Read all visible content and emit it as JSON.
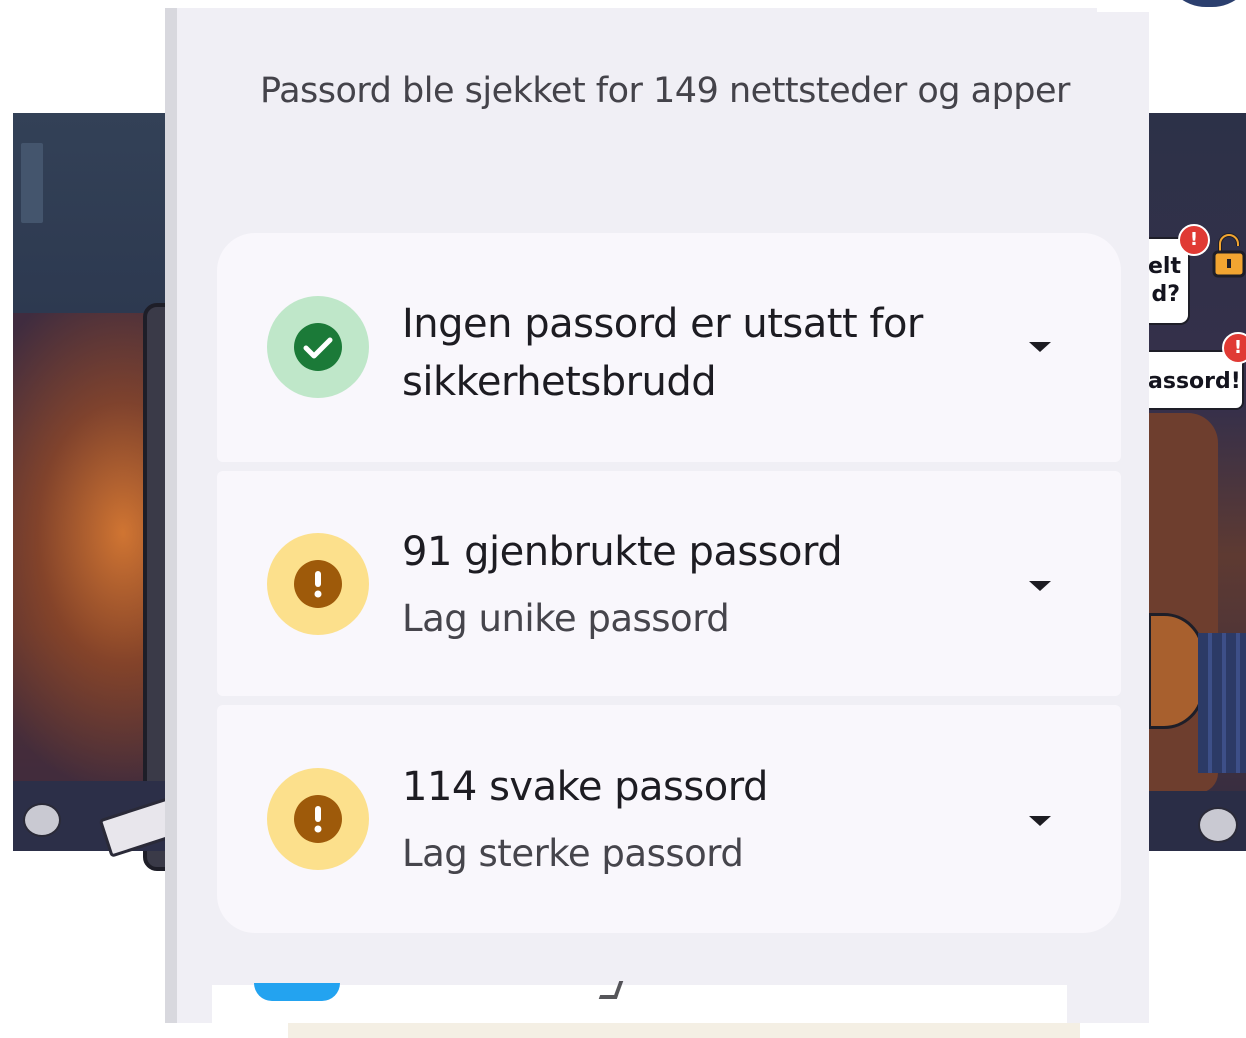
{
  "summary": {
    "text": "Passord ble sjekket for 149 nettsteder og apper"
  },
  "checks": [
    {
      "title": "Ingen passord er utsatt for sikkerhetsbrudd",
      "subtitle": "",
      "status": "ok",
      "icon": "check-circle-icon",
      "color": "#1b7a38"
    },
    {
      "title": "91 gjenbrukte passord",
      "subtitle": "Lag unike passord",
      "status": "warning",
      "icon": "exclamation-circle-icon",
      "color": "#9e5a0a"
    },
    {
      "title": "114 svake passord",
      "subtitle": "Lag sterke passord",
      "status": "warning",
      "icon": "exclamation-circle-icon",
      "color": "#9e5a0a"
    }
  ],
  "background": {
    "bubble_1": "elt\nd?",
    "bubble_2": "assord!",
    "alert_mark": "!"
  },
  "colors": {
    "screen_bg": "#f0eff5",
    "card_bg": "#f9f7fc",
    "ok_bg": "#bfe7c9",
    "warning_bg": "#fce08c"
  }
}
